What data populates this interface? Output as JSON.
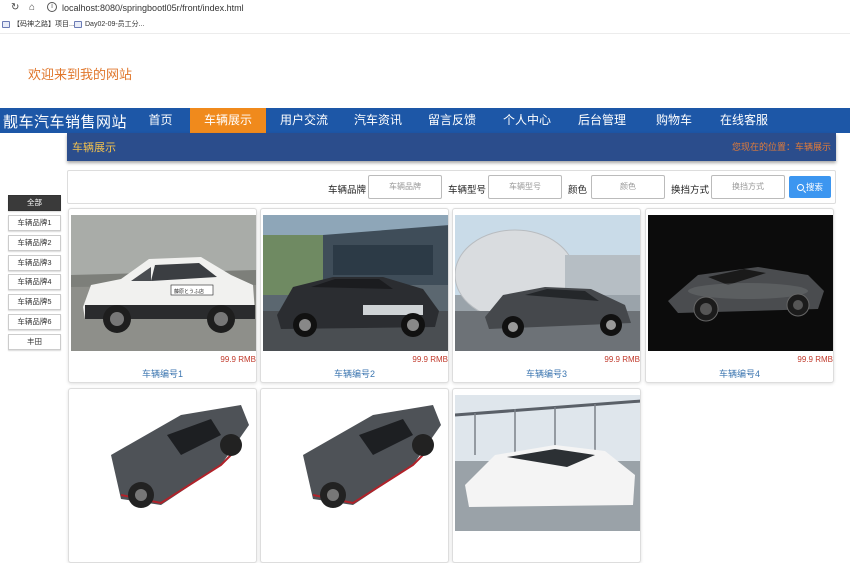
{
  "browser": {
    "url": "localhost:8080/springbootl05r/front/index.html",
    "bookmarks": [
      {
        "label": "【码神之路】项目..."
      },
      {
        "label": "Day02-09-员工分..."
      }
    ]
  },
  "header": {
    "welcome": "欢迎来到我的网站"
  },
  "navbar": {
    "brand": "靓车汽车销售网站",
    "items": [
      {
        "label": "首页"
      },
      {
        "label": "车辆展示"
      },
      {
        "label": "用户交流"
      },
      {
        "label": "汽车资讯"
      },
      {
        "label": "留言反馈"
      },
      {
        "label": "个人中心"
      },
      {
        "label": "后台管理"
      },
      {
        "label": "购物车"
      },
      {
        "label": "在线客服"
      }
    ],
    "active": "车辆展示"
  },
  "breadcrumb": {
    "title": "车辆展示",
    "location": "您现在的位置：车辆展示"
  },
  "search": {
    "fields": [
      {
        "label": "车辆品牌",
        "placeholder": "车辆品牌"
      },
      {
        "label": "车辆型号",
        "placeholder": "车辆型号"
      },
      {
        "label": "颜色",
        "placeholder": "颜色"
      },
      {
        "label": "换挡方式",
        "placeholder": "换挡方式"
      }
    ],
    "button": "搜索"
  },
  "sidebar": {
    "items": [
      {
        "label": "全部"
      },
      {
        "label": "车辆品牌1"
      },
      {
        "label": "车辆品牌2"
      },
      {
        "label": "车辆品牌3"
      },
      {
        "label": "车辆品牌4"
      },
      {
        "label": "车辆品牌5"
      },
      {
        "label": "车辆品牌6"
      },
      {
        "label": "丰田"
      }
    ]
  },
  "cars": [
    {
      "name": "车辆编号1",
      "price": "99.9 RMB"
    },
    {
      "name": "车辆编号2",
      "price": "99.9 RMB"
    },
    {
      "name": "车辆编号3",
      "price": "99.9 RMB"
    },
    {
      "name": "车辆编号4",
      "price": "99.9 RMB"
    },
    {
      "name": "",
      "price": ""
    },
    {
      "name": "",
      "price": ""
    },
    {
      "name": "",
      "price": ""
    }
  ],
  "colors": {
    "nav_bg": "#1d57a7",
    "nav_active": "#f08a1c",
    "crumb_bg": "#2b4d8c",
    "welcome": "#e0772c",
    "price": "#c0392b",
    "search_button": "#3c96f0"
  }
}
